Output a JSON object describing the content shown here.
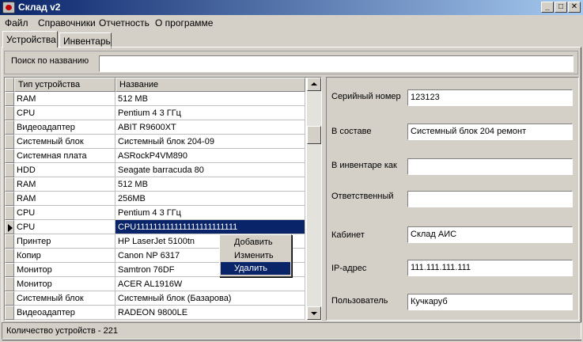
{
  "window": {
    "title": "Склад v2"
  },
  "menu": [
    "Файл",
    "Справочники",
    "Отчетность",
    "О программе"
  ],
  "tabs": [
    "Устройства",
    "Инвентарь"
  ],
  "search": {
    "label": "Поиск по названию",
    "value": ""
  },
  "table": {
    "columns": [
      "Тип устройства",
      "Название"
    ],
    "rows": [
      [
        "RAM",
        "512 MB"
      ],
      [
        "CPU",
        "Pentium 4 3 ГГц"
      ],
      [
        "Видеоадаптер",
        "ABIT R9600XT"
      ],
      [
        "Системный блок",
        "Системный блок 204-09"
      ],
      [
        "Системная плата",
        "ASRockP4VM890"
      ],
      [
        "HDD",
        "Seagate barracuda 80"
      ],
      [
        "RAM",
        "512 MB"
      ],
      [
        "RAM",
        "256MB"
      ],
      [
        "CPU",
        "Pentium 4 3 ГГц"
      ],
      [
        "CPU",
        "CPU111111111111111111111111"
      ],
      [
        "Принтер",
        "HP LaserJet 5100tn"
      ],
      [
        "Копир",
        "Canon NP 6317"
      ],
      [
        "Монитор",
        "Samtron 76DF"
      ],
      [
        "Монитор",
        "ACER AL1916W"
      ],
      [
        "Системный блок",
        "Системный блок (Базарова)"
      ],
      [
        "Видеоадаптер",
        "RADEON 9800LE"
      ]
    ]
  },
  "details": {
    "fields": [
      {
        "label": "Серийный номер",
        "value": "123123"
      },
      {
        "label": "В составе",
        "value": "Системный блок 204 ремонт"
      },
      {
        "label": "В инвентаре как",
        "value": ""
      },
      {
        "label": "Ответственный",
        "value": ""
      },
      {
        "label": "Кабинет",
        "value": "Склад АИС"
      },
      {
        "label": "IP-адрес",
        "value": "111.111.111.111"
      },
      {
        "label": "Пользователь",
        "value": "Кучкаруб"
      }
    ]
  },
  "context_menu": [
    "Добавить",
    "Изменить",
    "Удалить"
  ],
  "status": "Количество устройств - 221"
}
